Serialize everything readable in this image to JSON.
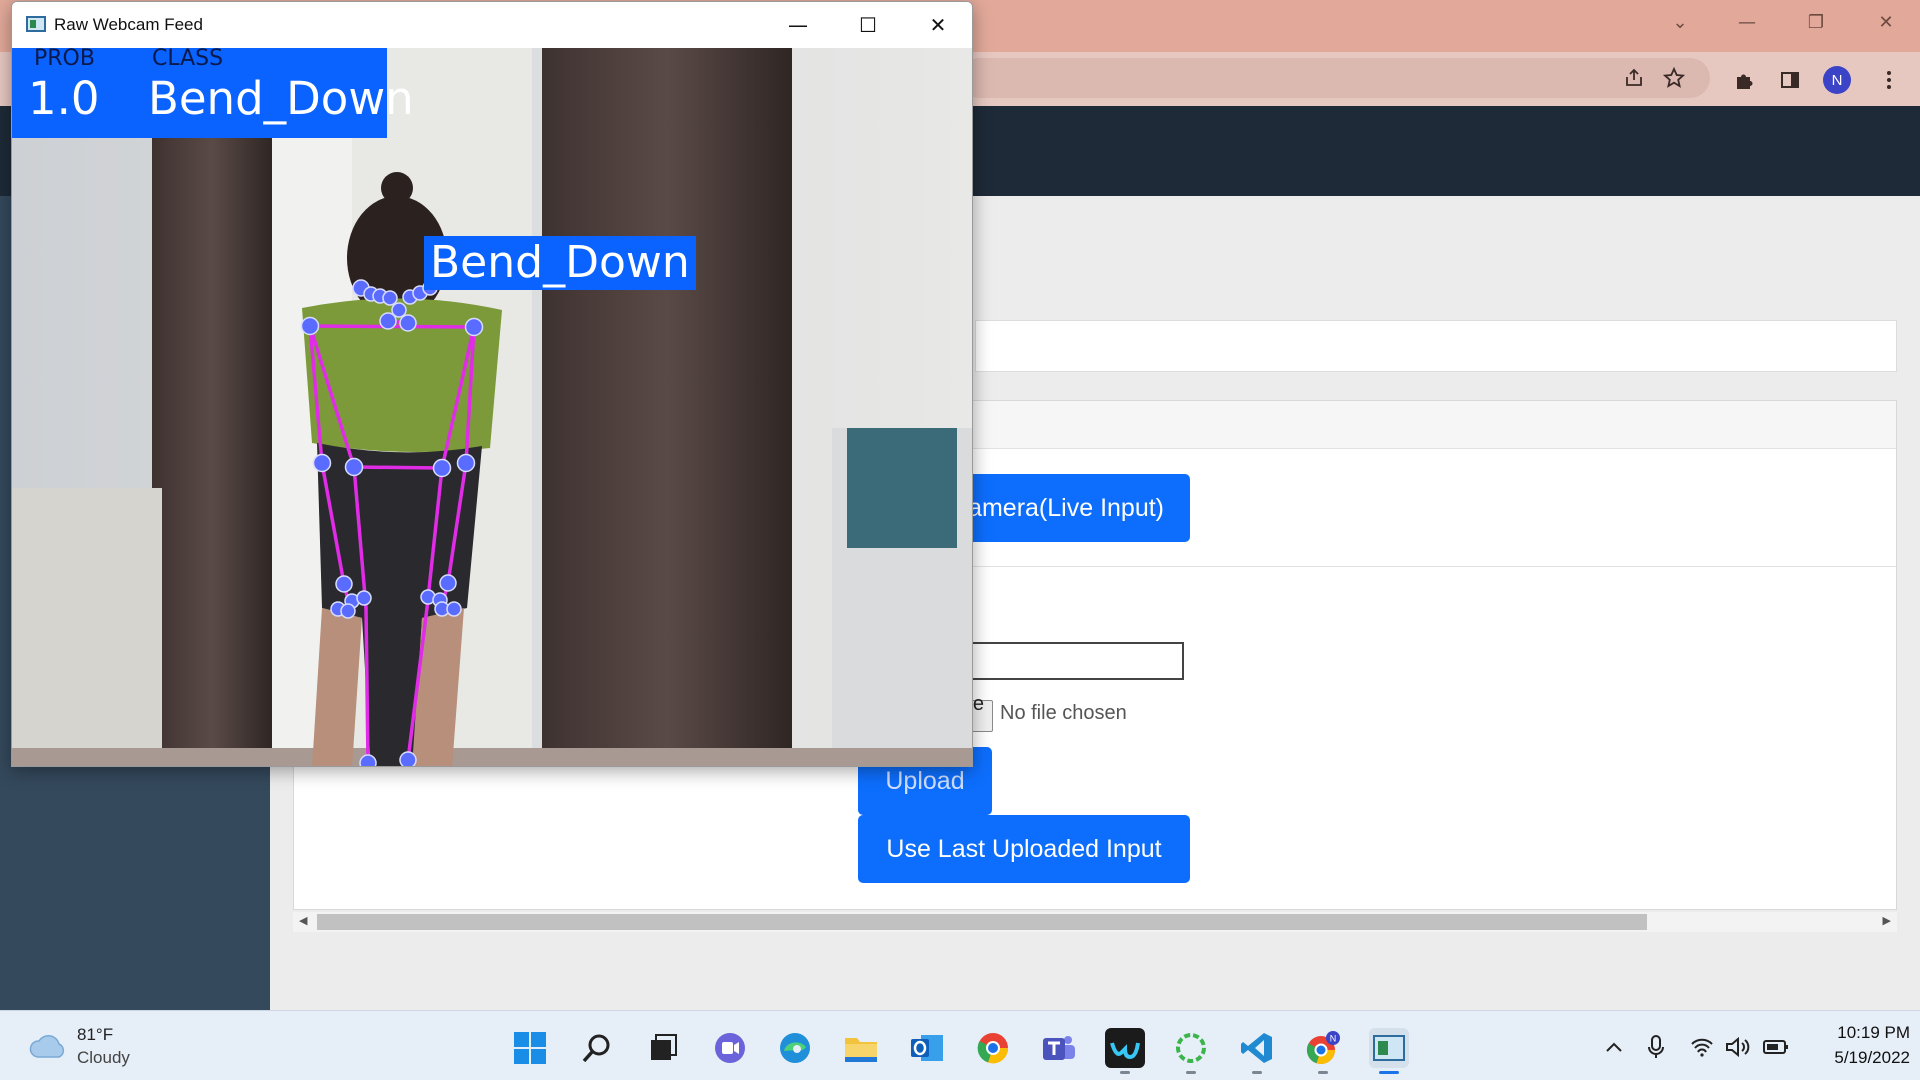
{
  "cv_window": {
    "title": "Raw Webcam Feed",
    "controls": {
      "minimize": "—",
      "maximize": "☐",
      "close": "✕"
    },
    "overlay": {
      "prob_header": "PROB",
      "class_header": "CLASS",
      "prob_value": "1.0",
      "class_value": "Bend_Down",
      "pose_label": "Bend_Down",
      "label_color": "#0a62ff",
      "skeleton_color": "#e02ce6",
      "landmark_color": "#5a6cff"
    }
  },
  "browser": {
    "titlebar_color": "#e2a99a",
    "controls": {
      "tab_search": "⌄",
      "minimize": "—",
      "restore": "❐",
      "close": "✕"
    },
    "toolbar_icons": [
      "share-icon",
      "bookmark-star-icon",
      "extensions-icon",
      "side-panel-icon",
      "kebab-menu-icon"
    ],
    "profile_initial": "N",
    "profile_color": "#3b43c7"
  },
  "page": {
    "camera_button_label": "Camera(Live Input)",
    "choose_file_label": "Choose File",
    "no_file_text": "No file chosen",
    "upload_button_label": "Upload",
    "last_input_button_label": "Use Last Uploaded Input",
    "accent_color": "#0d6efd"
  },
  "taskbar": {
    "weather": {
      "temp": "81°F",
      "desc": "Cloudy"
    },
    "apps": [
      "start-icon",
      "search-icon",
      "task-view-icon",
      "teams-chat-icon",
      "edge-icon",
      "file-explorer-icon",
      "outlook-icon",
      "chrome-icon",
      "teams-icon",
      "webex-icon",
      "spinner-app-icon",
      "vscode-icon",
      "chrome-profile-icon",
      "webcam-feed-app-icon"
    ],
    "tray": {
      "time": "10:19 PM",
      "date": "5/19/2022"
    }
  }
}
